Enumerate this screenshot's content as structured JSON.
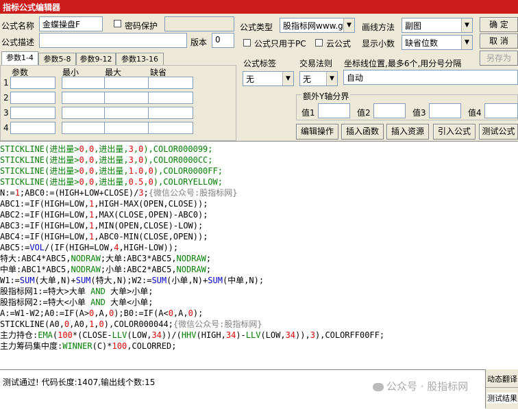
{
  "window": {
    "title": "指标公式编辑器"
  },
  "form": {
    "name_label": "公式名称",
    "name_value": "金蝶操盘F",
    "password_label": "密码保护",
    "desc_label": "公式描述",
    "desc_value": "",
    "version_label": "版本",
    "version_value": "0",
    "type_label": "公式类型",
    "type_value": "股指标网www.g",
    "draw_label": "画线方法",
    "draw_value": "副图",
    "pc_only_label": "公式只用于PC",
    "cloud_label": "云公式",
    "decimals_label": "显示小数",
    "decimals_value": "缺省位数"
  },
  "buttons": {
    "confirm": "确  定",
    "cancel": "取  消",
    "save_as": "另存为",
    "edit_op": "编辑操作",
    "insert_func": "插入函数",
    "insert_res": "插入资源",
    "import": "引入公式",
    "test": "测试公式"
  },
  "tabs": [
    "参数1-4",
    "参数5-8",
    "参数9-12",
    "参数13-16"
  ],
  "param_headers": [
    "参数",
    "最小",
    "最大",
    "缺省"
  ],
  "param_rows": [
    "1",
    "2",
    "3",
    "4"
  ],
  "right": {
    "label_tag": "公式标签",
    "tag_value": "无",
    "trade_rule_label": "交易法则",
    "trade_rule_value": "无",
    "axis_label": "坐标线位置,最多6个,用分号分隔",
    "axis_value": "自动",
    "extra_y_label": "额外Y轴分界",
    "value_labels": [
      "值1",
      "值2",
      "值3",
      "值4"
    ]
  },
  "code_lines": [
    [
      [
        "STICKLINE(进出量>",
        "k"
      ],
      [
        "0",
        "n"
      ],
      [
        ",",
        "k"
      ],
      [
        "0",
        "n"
      ],
      [
        ",进出量,",
        "k"
      ],
      [
        "3",
        "n"
      ],
      [
        ",",
        "k"
      ],
      [
        "0",
        "n"
      ],
      [
        "),COLOR000099;",
        "k"
      ]
    ],
    [
      [
        "STICKLINE(进出量>",
        "k"
      ],
      [
        "0",
        "n"
      ],
      [
        ",",
        "k"
      ],
      [
        "0",
        "n"
      ],
      [
        ",进出量,",
        "k"
      ],
      [
        "3",
        "n"
      ],
      [
        ",",
        "k"
      ],
      [
        "0",
        "n"
      ],
      [
        "),COLOR0000CC;",
        "k"
      ]
    ],
    [
      [
        "STICKLINE(进出量>",
        "k"
      ],
      [
        "0",
        "n"
      ],
      [
        ",",
        "k"
      ],
      [
        "0",
        "n"
      ],
      [
        ",进出量,",
        "k"
      ],
      [
        "1.0",
        "n"
      ],
      [
        ",",
        "k"
      ],
      [
        "0",
        "n"
      ],
      [
        "),COLOR0000FF;",
        "k"
      ]
    ],
    [
      [
        "STICKLINE(进出量>",
        "k"
      ],
      [
        "0",
        "n"
      ],
      [
        ",",
        "k"
      ],
      [
        "0",
        "n"
      ],
      [
        ",进出量,",
        "k"
      ],
      [
        "0.5",
        "n"
      ],
      [
        ",",
        "k"
      ],
      [
        "0",
        "n"
      ],
      [
        "),COLORYELLOW;",
        "k"
      ]
    ],
    [
      [
        "N:=",
        ""
      ],
      [
        "1",
        "n"
      ],
      [
        ";ABC0:=(HIGH+LOW+CLOSE)/",
        ""
      ],
      [
        "3",
        "n"
      ],
      [
        ";",
        ""
      ],
      [
        "{微信公众号:股指标网}",
        "c"
      ]
    ],
    [
      [
        "ABC1:=IF(HIGH=LOW,",
        ""
      ],
      [
        "1",
        "n"
      ],
      [
        ",HIGH-MAX(OPEN,CLOSE));",
        ""
      ]
    ],
    [
      [
        "ABC2:=IF(HIGH=LOW,",
        ""
      ],
      [
        "1",
        "n"
      ],
      [
        ",MAX(CLOSE,OPEN)-ABC0);",
        ""
      ]
    ],
    [
      [
        "ABC3:=IF(HIGH=LOW,",
        ""
      ],
      [
        "1",
        "n"
      ],
      [
        ",MIN(OPEN,CLOSE)-LOW);",
        ""
      ]
    ],
    [
      [
        "ABC4:=IF(HIGH=LOW,",
        ""
      ],
      [
        "1",
        "n"
      ],
      [
        ",ABC0-MIN(CLOSE,OPEN));",
        ""
      ]
    ],
    [
      [
        "ABC5:=",
        ""
      ],
      [
        "VOL",
        "f"
      ],
      [
        "/(IF(HIGH=LOW,",
        ""
      ],
      [
        "4",
        "n"
      ],
      [
        ",HIGH-LOW));",
        ""
      ]
    ],
    [
      [
        "特大:ABC4*ABC5,",
        ""
      ],
      [
        "NODRAW",
        "k"
      ],
      [
        ";大单:ABC3*ABC5,",
        ""
      ],
      [
        "NODRAW",
        "k"
      ],
      [
        ";",
        ""
      ]
    ],
    [
      [
        "中单:ABC1*ABC5,",
        ""
      ],
      [
        "NODRAW",
        "k"
      ],
      [
        ";小单:ABC2*ABC5,",
        ""
      ],
      [
        "NODRAW",
        "k"
      ],
      [
        ";",
        ""
      ]
    ],
    [
      [
        "W1:=",
        ""
      ],
      [
        "SUM",
        "f"
      ],
      [
        "(大单,N)+",
        ""
      ],
      [
        "SUM",
        "f"
      ],
      [
        "(特大,N);W2:=",
        ""
      ],
      [
        "SUM",
        "f"
      ],
      [
        "(小单,N)+",
        ""
      ],
      [
        "SUM",
        "f"
      ],
      [
        "(中单,N);",
        ""
      ]
    ],
    [
      [
        "股指标网1:=特大>大单 ",
        ""
      ],
      [
        "AND",
        "k"
      ],
      [
        " 大单>小单;",
        ""
      ]
    ],
    [
      [
        "股指标网2:=特大<小单 ",
        ""
      ],
      [
        "AND",
        "k"
      ],
      [
        " 大单<小单;",
        ""
      ]
    ],
    [
      [
        "A:=W1-W2;A0:=IF(A>",
        ""
      ],
      [
        "0",
        "n"
      ],
      [
        ",A,",
        ""
      ],
      [
        "0",
        "n"
      ],
      [
        ");B0:=IF(A<",
        ""
      ],
      [
        "0",
        "n"
      ],
      [
        ",A,",
        ""
      ],
      [
        "0",
        "n"
      ],
      [
        ");",
        ""
      ]
    ],
    [
      [
        "STICKLINE(A0,",
        ""
      ],
      [
        "0",
        "n"
      ],
      [
        ",A0,",
        ""
      ],
      [
        "1",
        "n"
      ],
      [
        ",",
        ""
      ],
      [
        "0",
        "n"
      ],
      [
        "),COLOR000044;",
        ""
      ],
      [
        "{微信公众号:股指标网}",
        "c"
      ]
    ],
    [
      [
        "主力持仓:",
        ""
      ],
      [
        "EMA",
        "k"
      ],
      [
        "(",
        ""
      ],
      [
        "100",
        "n"
      ],
      [
        "*(CLOSE-",
        ""
      ],
      [
        "LLV",
        "k"
      ],
      [
        "(LOW,",
        ""
      ],
      [
        "34",
        "n"
      ],
      [
        "))/(",
        ""
      ],
      [
        "HHV",
        "k"
      ],
      [
        "(HIGH,",
        ""
      ],
      [
        "34",
        "n"
      ],
      [
        ")-",
        ""
      ],
      [
        "LLV",
        "k"
      ],
      [
        "(LOW,",
        ""
      ],
      [
        "34",
        "n"
      ],
      [
        ")),",
        ""
      ],
      [
        "3",
        "n"
      ],
      [
        "),COLORFF00FF;",
        ""
      ]
    ],
    [
      [
        "主力筹码集中度:",
        ""
      ],
      [
        "WINNER",
        "k"
      ],
      [
        "(C)*",
        ""
      ],
      [
        "100",
        "n"
      ],
      [
        ",COLORRED;",
        ""
      ]
    ]
  ],
  "status": {
    "message": "测试通过! 代码长度:1407,输出线个数:15",
    "side_tab1": "动态翻译",
    "side_tab2": "测试结果",
    "watermark": "公众号 · 股指标网"
  }
}
